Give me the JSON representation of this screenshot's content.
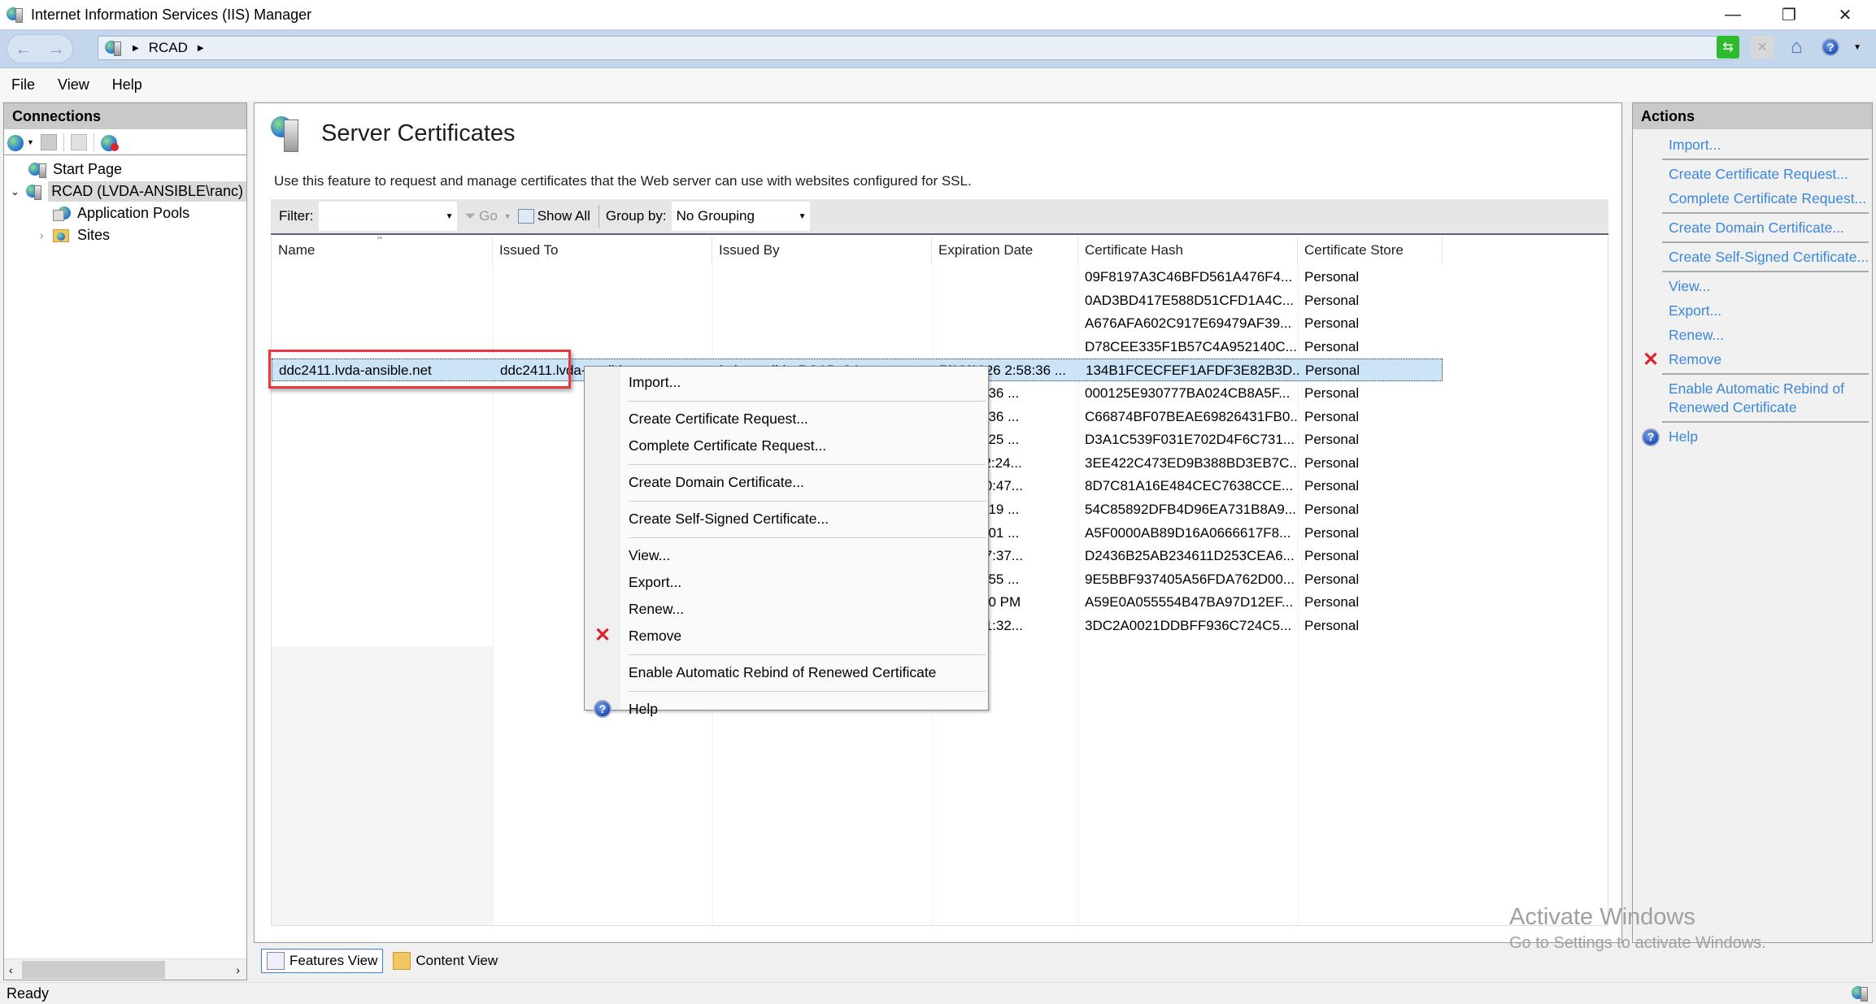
{
  "window": {
    "title": "Internet Information Services (IIS) Manager",
    "controls": {
      "minimize": "—",
      "restore": "❐",
      "close": "✕"
    }
  },
  "navbar": {
    "back_icon": "←",
    "forward_icon": "→",
    "breadcrumb": [
      "RCAD"
    ],
    "icons": [
      "refresh-icon",
      "stop-icon",
      "home-icon",
      "help-icon"
    ]
  },
  "menu": {
    "items": [
      "File",
      "View",
      "Help"
    ]
  },
  "connections": {
    "title": "Connections",
    "tree": [
      {
        "label": "Start Page",
        "level": "root"
      },
      {
        "label": "RCAD (LVDA-ANSIBLE\\ranc)",
        "level": "root",
        "expanded": true,
        "selected": true
      },
      {
        "label": "Application Pools",
        "level": "child"
      },
      {
        "label": "Sites",
        "level": "child",
        "collapsed": true
      }
    ]
  },
  "main": {
    "title": "Server Certificates",
    "description": "Use this feature to request and manage certificates that the Web server can use with websites configured for SSL.",
    "filter": {
      "label": "Filter:",
      "value": "",
      "go_label": "Go",
      "show_all_label": "Show All",
      "group_by_label": "Group by:",
      "group_by_value": "No Grouping"
    },
    "columns": [
      "Name",
      "Issued To",
      "Issued By",
      "Expiration Date",
      "Certificate Hash",
      "Certificate Store"
    ],
    "rows": [
      {
        "name": "",
        "issued_to": "",
        "issued_by": "",
        "expiration": "",
        "hash": "09F8197A3C46BFD561A476F4...",
        "store": "Personal"
      },
      {
        "name": "",
        "issued_to": "",
        "issued_by": "",
        "expiration": "",
        "hash": "0AD3BD417E588D51CFD1A4C...",
        "store": "Personal"
      },
      {
        "name": "",
        "issued_to": "",
        "issued_by": "",
        "expiration": "",
        "hash": "A676AFA602C917E69479AF39...",
        "store": "Personal"
      },
      {
        "name": "",
        "issued_to": "",
        "issued_by": "",
        "expiration": "",
        "hash": "D78CEE335F1B57C4A952140C...",
        "store": "Personal"
      },
      {
        "name": "ddc2411.lvda-ansible.net",
        "issued_to": "ddc2411.lvda-ansible.net",
        "issued_by": "lvda-ansible-RCAD-CA",
        "expiration": "7/23/2026 2:58:36 ...",
        "hash": "134B1FCECFEF1AFDF3E82B3D...",
        "store": "Personal",
        "selected": true
      },
      {
        "name": "",
        "issued_to": "",
        "issued_by": "",
        "expiration": "26 2:58:36 ...",
        "hash": "000125E930777BA024CB8A5F...",
        "store": "Personal"
      },
      {
        "name": "",
        "issued_to": "",
        "issued_by": "",
        "expiration": "26 2:58:36 ...",
        "hash": "C66874BF07BEAE69826431FB0...",
        "store": "Personal"
      },
      {
        "name": "",
        "issued_to": "",
        "issued_by": "",
        "expiration": "24 3:53:25 ...",
        "hash": "D3A1C539F031E702D4F6C731...",
        "store": "Personal"
      },
      {
        "name": "",
        "issued_to": "",
        "issued_by": "",
        "expiration": "23 11:02:24...",
        "hash": "3EE422C473ED9B388BD3EB7C...",
        "store": "Personal"
      },
      {
        "name": "",
        "issued_to": "",
        "issued_by": "",
        "expiration": "25 10:30:47...",
        "hash": "8D7C81A16E484CEC7638CCE...",
        "store": "Personal"
      },
      {
        "name": "",
        "issued_to": "",
        "issued_by": "",
        "expiration": "23 4:30:19 ...",
        "hash": "54C85892DFB4D96EA731B8A9...",
        "store": "Personal"
      },
      {
        "name": "",
        "issued_to": "",
        "issued_by": "",
        "expiration": "25 4:30:01 ...",
        "hash": "A5F0000AB89D16A0666617F8...",
        "store": "Personal"
      },
      {
        "name": "",
        "issued_to": "",
        "issued_by": "",
        "expiration": "25 10:57:37...",
        "hash": "D2436B25AB234611D253CEA6...",
        "store": "Personal"
      },
      {
        "name": "",
        "issued_to": "",
        "issued_by": "",
        "expiration": "26 4:54:55 ...",
        "hash": "9E5BBF937405A56FDA762D00...",
        "store": "Personal"
      },
      {
        "name": "",
        "issued_to": "",
        "issued_by": "",
        "expiration": "5 3:25:20 PM",
        "hash": "A59E0A055554B47BA97D12EF...",
        "store": "Personal"
      },
      {
        "name": "",
        "issued_to": "",
        "issued_by": "",
        "expiration": "25 10:41:32...",
        "hash": "3DC2A0021DDBFF936C724C5...",
        "store": "Personal"
      }
    ],
    "view_tabs": [
      {
        "label": "Features View",
        "active": true
      },
      {
        "label": "Content View",
        "active": false
      }
    ]
  },
  "context_menu": {
    "items": [
      {
        "label": "Import...",
        "icon": ""
      },
      {
        "sep": true
      },
      {
        "label": "Create Certificate Request...",
        "icon": ""
      },
      {
        "label": "Complete Certificate Request...",
        "icon": ""
      },
      {
        "sep": true
      },
      {
        "label": "Create Domain Certificate...",
        "icon": ""
      },
      {
        "sep": true
      },
      {
        "label": "Create Self-Signed Certificate...",
        "icon": ""
      },
      {
        "sep": true
      },
      {
        "label": "View...",
        "icon": ""
      },
      {
        "label": "Export...",
        "icon": ""
      },
      {
        "label": "Renew...",
        "icon": ""
      },
      {
        "label": "Remove",
        "icon": "remove"
      },
      {
        "sep": true
      },
      {
        "label": "Enable Automatic Rebind of Renewed Certificate",
        "icon": ""
      },
      {
        "sep": true
      },
      {
        "label": "Help",
        "icon": "help"
      }
    ]
  },
  "actions": {
    "title": "Actions",
    "items": [
      {
        "label": "Import...",
        "icon": ""
      },
      {
        "sep": true
      },
      {
        "label": "Create Certificate Request...",
        "icon": ""
      },
      {
        "label": "Complete Certificate Request...",
        "icon": ""
      },
      {
        "sep": true
      },
      {
        "label": "Create Domain Certificate...",
        "icon": ""
      },
      {
        "sep": true
      },
      {
        "label": "Create Self-Signed Certificate...",
        "icon": ""
      },
      {
        "sep": true
      },
      {
        "label": "View...",
        "icon": ""
      },
      {
        "label": "Export...",
        "icon": ""
      },
      {
        "label": "Renew...",
        "icon": ""
      },
      {
        "label": "Remove",
        "icon": "remove"
      },
      {
        "sep": true
      },
      {
        "label": "Enable Automatic Rebind of Renewed Certificate",
        "icon": ""
      },
      {
        "sep": true
      },
      {
        "label": "Help",
        "icon": "help"
      }
    ]
  },
  "status": {
    "text": "Ready"
  },
  "watermark": {
    "line1": "Activate Windows",
    "line2": "Go to Settings to activate Windows."
  },
  "colors": {
    "accent_link": "#3b87d8",
    "selection": "#cce4f7",
    "highlight_box": "#e8383d",
    "remove_icon": "#d9242c"
  }
}
